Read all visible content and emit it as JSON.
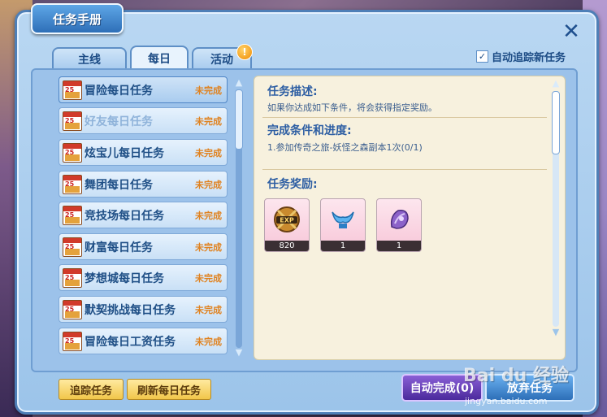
{
  "window": {
    "title": "任务手册"
  },
  "tabs": [
    {
      "label": "主线",
      "active": false
    },
    {
      "label": "每日",
      "active": true
    },
    {
      "label": "活动",
      "active": false
    }
  ],
  "alert_icon_glyph": "!",
  "track_new_quests": {
    "label": "自动追踪新任务",
    "checked": true
  },
  "quest_list": [
    {
      "name": "冒险每日任务",
      "status": "未完成",
      "selected": true
    },
    {
      "name": "好友每日任务",
      "status": "未完成",
      "dim": true
    },
    {
      "name": "炫宝儿每日任务",
      "status": "未完成"
    },
    {
      "name": "舞团每日任务",
      "status": "未完成"
    },
    {
      "name": "竞技场每日任务",
      "status": "未完成"
    },
    {
      "name": "财富每日任务",
      "status": "未完成"
    },
    {
      "name": "梦想城每日任务",
      "status": "未完成"
    },
    {
      "name": "默契挑战每日任务",
      "status": "未完成"
    },
    {
      "name": "冒险每日工资任务",
      "status": "未完成"
    }
  ],
  "calendar_icon_text": "25",
  "detail": {
    "description_heading": "任务描述:",
    "description_text": "如果你达成如下条件，将会获得指定奖励。",
    "progress_heading": "完成条件和进度:",
    "progress_text": "1.参加传奇之旅-妖怪之森副本1次(0/1)",
    "reward_heading": "任务奖励:"
  },
  "rewards": [
    {
      "icon": "exp-badge-icon",
      "count": "820",
      "label": "EXP"
    },
    {
      "icon": "blue-wing-item-icon",
      "count": "1"
    },
    {
      "icon": "purple-flower-item-icon",
      "count": "1"
    }
  ],
  "buttons": {
    "track": "追踪任务",
    "refresh": "刷新每日任务",
    "auto_complete": "自动完成(0)",
    "abandon": "放弃任务"
  },
  "watermark": {
    "brand": "Bai du 经验",
    "url": "jingyan.baidu.com"
  },
  "colors": {
    "accent": "#2e6fb8",
    "status": "#e0821f",
    "frame": "#4e7fb7"
  }
}
